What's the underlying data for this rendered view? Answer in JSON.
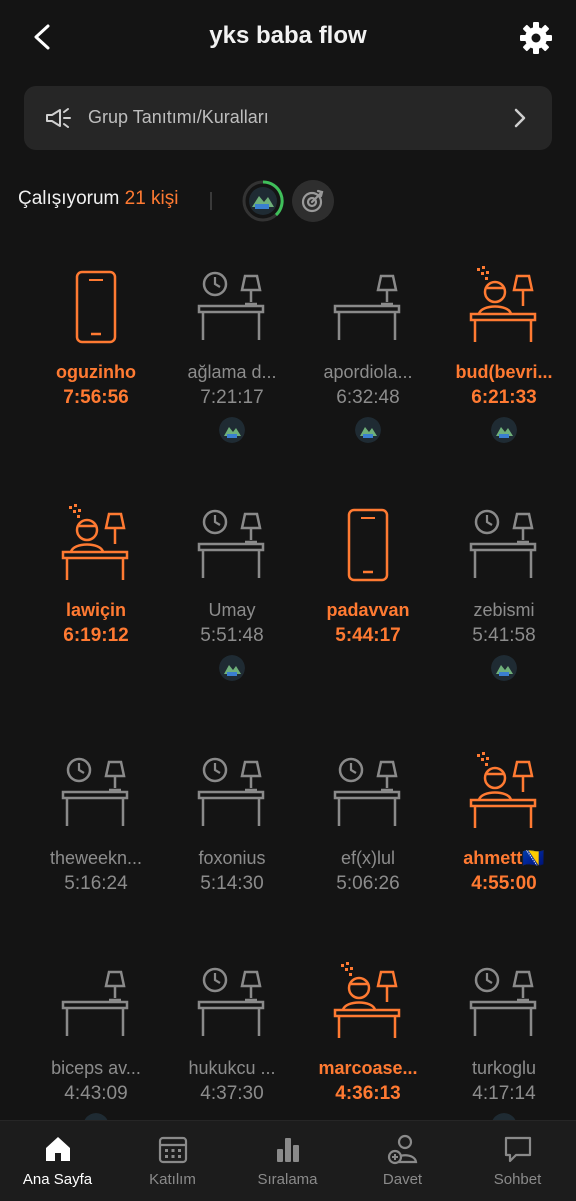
{
  "header": {
    "title": "yks baba flow"
  },
  "rules_bar": {
    "label": "Grup Tanıtımı/Kuralları"
  },
  "studying": {
    "label": "Çalışıyorum",
    "count": "21 kişi"
  },
  "colors": {
    "accent": "#ff7a32",
    "inactive": "#8c8c8c",
    "background": "#141414"
  },
  "members": [
    {
      "name": "oguzinho",
      "time": "7:56:56",
      "state": "phone",
      "active": true,
      "badge": false
    },
    {
      "name": "ağlama d...",
      "time": "7:21:17",
      "state": "desk",
      "active": false,
      "badge": true
    },
    {
      "name": "apordiola...",
      "time": "6:32:48",
      "state": "desk-empty",
      "active": false,
      "badge": true
    },
    {
      "name": "bud(bevri...",
      "time": "6:21:33",
      "state": "studying",
      "active": true,
      "badge": true
    },
    {
      "name": "lawiçin",
      "time": "6:19:12",
      "state": "studying",
      "active": true,
      "badge": false
    },
    {
      "name": "Umay",
      "time": "5:51:48",
      "state": "desk",
      "active": false,
      "badge": true
    },
    {
      "name": "padavvan",
      "time": "5:44:17",
      "state": "phone",
      "active": true,
      "badge": false
    },
    {
      "name": "zebismi",
      "time": "5:41:58",
      "state": "desk",
      "active": false,
      "badge": true
    },
    {
      "name": "theweekn...",
      "time": "5:16:24",
      "state": "desk",
      "active": false,
      "badge": false
    },
    {
      "name": "foxonius",
      "time": "5:14:30",
      "state": "desk",
      "active": false,
      "badge": false
    },
    {
      "name": "ef(x)lul",
      "time": "5:06:26",
      "state": "desk",
      "active": false,
      "badge": false
    },
    {
      "name": "ahmett🇧🇦",
      "time": "4:55:00",
      "state": "studying",
      "active": true,
      "badge": false
    },
    {
      "name": "biceps av...",
      "time": "4:43:09",
      "state": "desk-empty",
      "active": false,
      "badge": true
    },
    {
      "name": "hukukcu ...",
      "time": "4:37:30",
      "state": "desk",
      "active": false,
      "badge": false
    },
    {
      "name": "marcoase...",
      "time": "4:36:13",
      "state": "studying",
      "active": true,
      "badge": false
    },
    {
      "name": "turkoglu",
      "time": "4:17:14",
      "state": "desk",
      "active": false,
      "badge": true
    }
  ],
  "tabs": [
    {
      "label": "Ana Sayfa",
      "icon": "home-icon",
      "active": true
    },
    {
      "label": "Katılım",
      "icon": "calendar-icon",
      "active": false
    },
    {
      "label": "Sıralama",
      "icon": "bar-chart-icon",
      "active": false
    },
    {
      "label": "Davet",
      "icon": "add-user-icon",
      "active": false
    },
    {
      "label": "Sohbet",
      "icon": "chat-icon",
      "active": false
    }
  ]
}
